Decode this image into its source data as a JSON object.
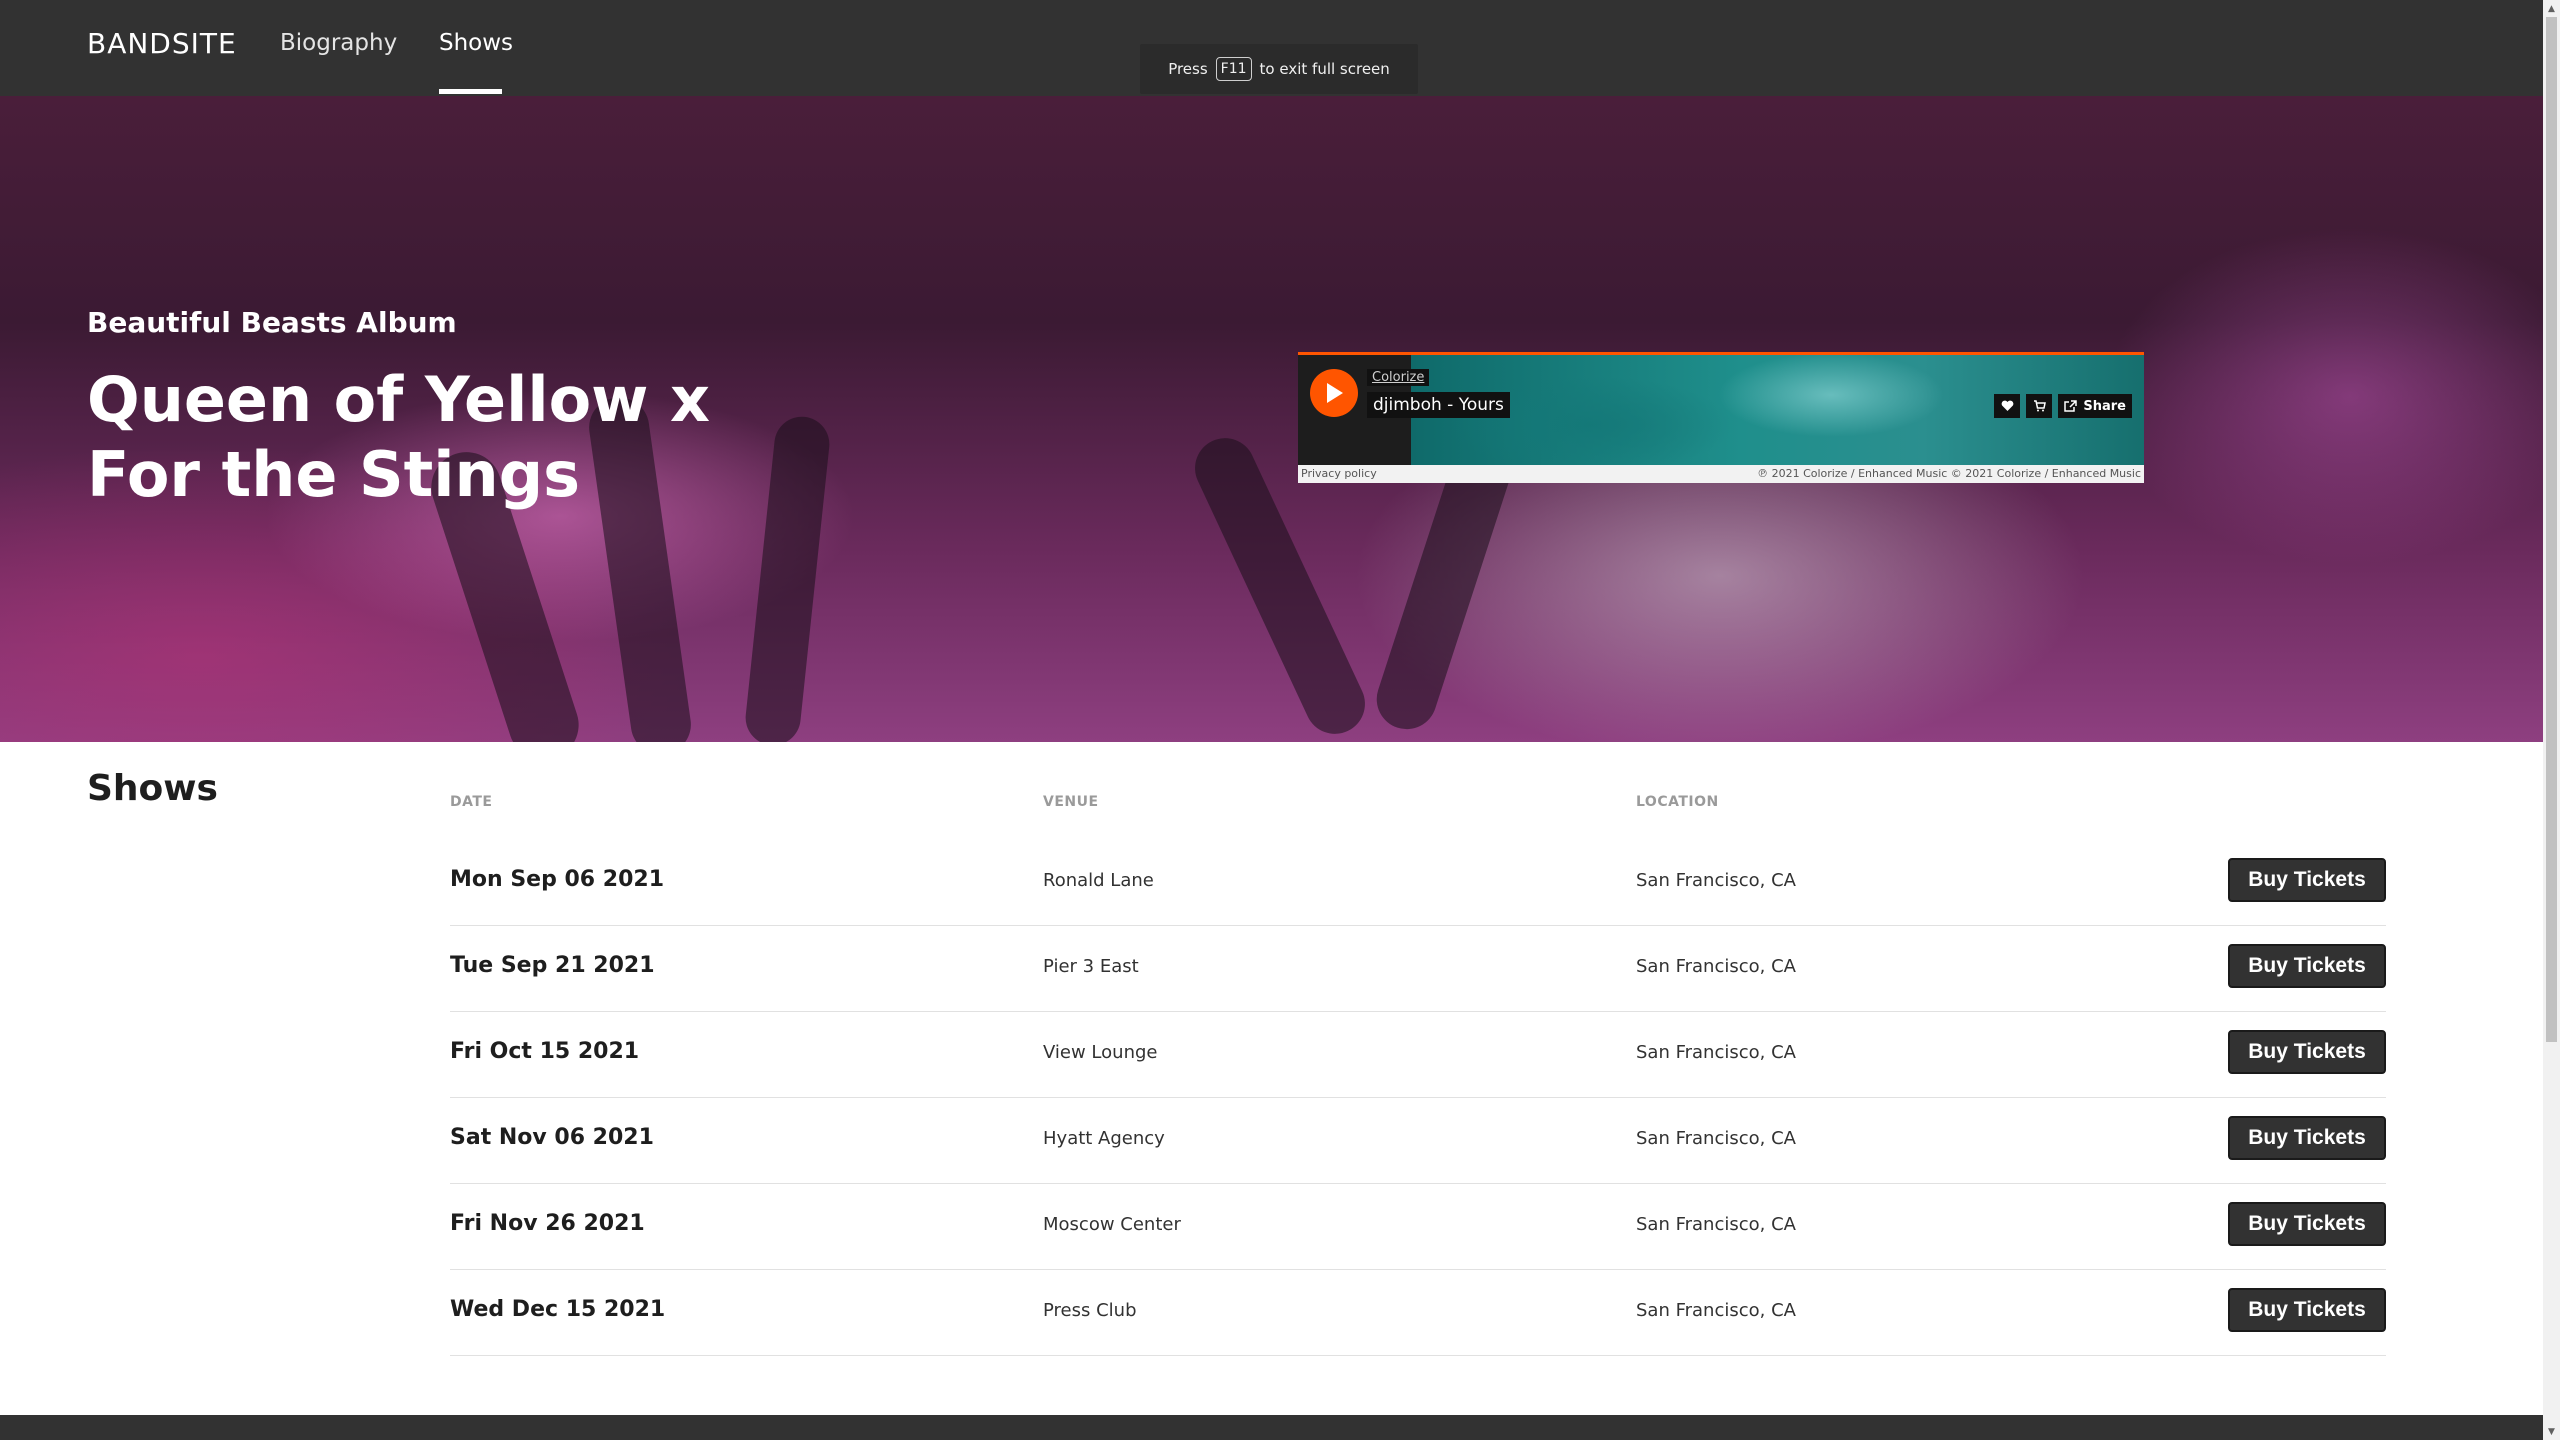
{
  "nav": {
    "logo": "BANDSITE",
    "links": [
      {
        "label": "Biography"
      },
      {
        "label": "Shows"
      }
    ]
  },
  "toast": {
    "before": "Press",
    "key": "F11",
    "after": "to exit full screen"
  },
  "hero": {
    "subtitle": "Beautiful Beasts Album",
    "title": "Queen of Yellow x For the Stings"
  },
  "player": {
    "artist": "Colorize",
    "track": "djimboh - Yours",
    "share_label": "Share",
    "privacy": "Privacy policy",
    "copyright": "℗ 2021 Colorize / Enhanced Music © 2021 Colorize / Enhanced Music",
    "icons": [
      "play-icon",
      "heart-icon",
      "cart-icon",
      "share-icon"
    ]
  },
  "shows": {
    "heading": "Shows",
    "columns": [
      "DATE",
      "VENUE",
      "LOCATION"
    ],
    "button_label": "Buy Tickets",
    "rows": [
      {
        "date": "Mon Sep 06 2021",
        "venue": "Ronald Lane",
        "location": "San Francisco, CA"
      },
      {
        "date": "Tue Sep 21 2021",
        "venue": "Pier 3 East",
        "location": "San Francisco, CA"
      },
      {
        "date": "Fri Oct 15 2021",
        "venue": "View Lounge",
        "location": "San Francisco, CA"
      },
      {
        "date": "Sat Nov 06 2021",
        "venue": "Hyatt Agency",
        "location": "San Francisco, CA"
      },
      {
        "date": "Fri Nov 26 2021",
        "venue": "Moscow Center",
        "location": "San Francisco, CA"
      },
      {
        "date": "Wed Dec 15 2021",
        "venue": "Press Club",
        "location": "San Francisco, CA"
      }
    ]
  },
  "colors": {
    "nav_bg": "#323232",
    "accent": "#ff5500",
    "button_bg": "#323232"
  }
}
